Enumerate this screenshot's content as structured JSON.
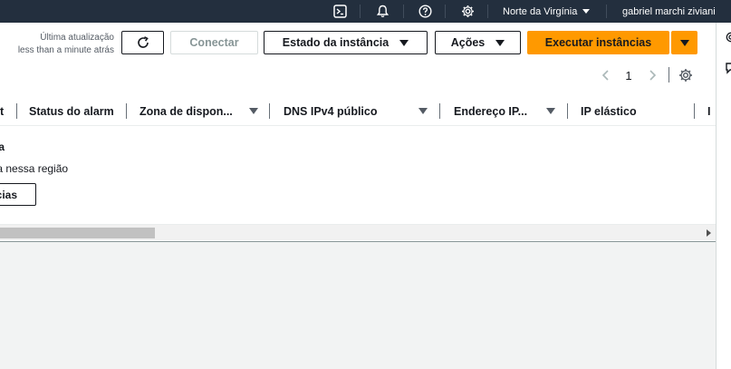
{
  "topnav": {
    "icons": [
      "cloudshell-icon",
      "bell-icon",
      "help-icon",
      "settings-icon"
    ],
    "region": "Norte da Virgínia",
    "user": "gabriel marchi ziviani"
  },
  "toolbar": {
    "last_update_label": "Última atualização",
    "last_update_value": "less than a minute atrás",
    "connect_label": "Conectar",
    "instance_state_label": "Estado da instância",
    "actions_label": "Ações",
    "launch_label": "Executar instâncias"
  },
  "pagination": {
    "current_page": "1"
  },
  "table": {
    "columns": [
      {
        "label": "t"
      },
      {
        "label": "Status do alarm"
      },
      {
        "label": "Zona de dispon..."
      },
      {
        "label": "DNS IPv4 público"
      },
      {
        "label": "Endereço IP..."
      },
      {
        "label": "IP elástico"
      },
      {
        "label": "I"
      }
    ]
  },
  "empty_state": {
    "title": "ncia",
    "description": "ncia nessa região",
    "button_label": "cias"
  },
  "colors": {
    "nav_bg": "#232f3e",
    "primary": "#ff9900",
    "text": "#16191f",
    "muted": "#545b64"
  }
}
